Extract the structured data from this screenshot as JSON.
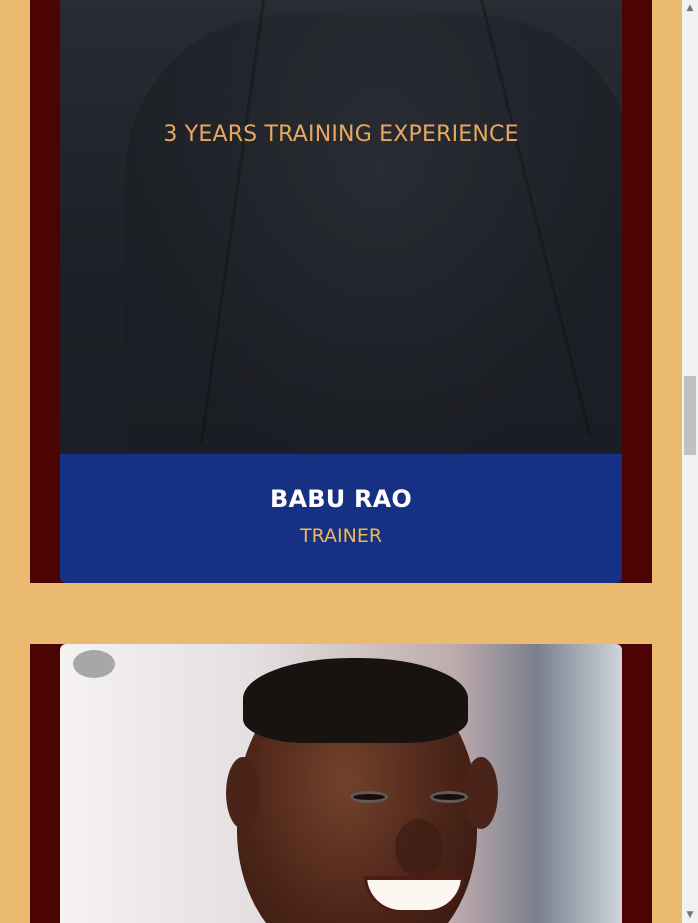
{
  "trainer_cards": [
    {
      "experience_text": "3 YEARS TRAINING EXPERIENCE",
      "name": "BABU RAO",
      "role": "TRAINER",
      "image_description": "trainer-photo-dark-shirt"
    },
    {
      "image_description": "trainer-photo-smiling-man"
    }
  ],
  "scrollbar": {
    "up_icon": "chevron-up-icon",
    "down_icon": "chevron-down-icon",
    "thumb_position_percent": 41
  },
  "colors": {
    "page_background": "#ebba71",
    "card_background": "#4b0303",
    "name_panel": "#163183",
    "experience_text": "#e8a95e",
    "role_text": "#f0b84f",
    "name_text": "#ffffff"
  }
}
